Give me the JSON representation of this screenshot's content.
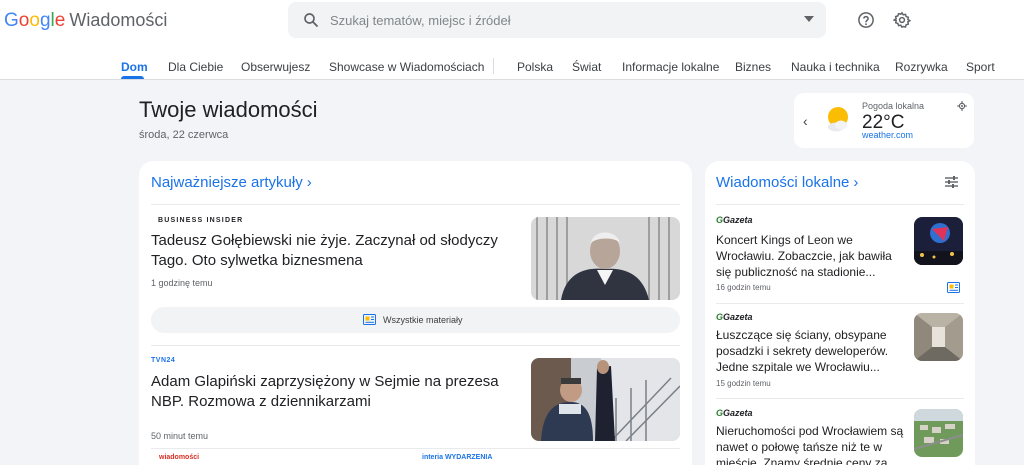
{
  "app": {
    "logo_letters": [
      "G",
      "o",
      "o",
      "g",
      "l",
      "e"
    ],
    "product": "Wiadomości"
  },
  "search": {
    "placeholder": "Szukaj tematów, miejsc i źródeł"
  },
  "header_icons": [
    "help-icon",
    "settings-icon"
  ],
  "nav": {
    "tabs": [
      {
        "label": "Dom",
        "active": true
      },
      {
        "label": "Dla Ciebie"
      },
      {
        "label": "Obserwujesz"
      },
      {
        "label": "Showcase w Wiadomościach"
      },
      {
        "label": "Polska"
      },
      {
        "label": "Świat"
      },
      {
        "label": "Informacje lokalne"
      },
      {
        "label": "Biznes"
      },
      {
        "label": "Nauka i technika"
      },
      {
        "label": "Rozrywka"
      },
      {
        "label": "Sport"
      }
    ]
  },
  "page": {
    "title": "Twoje wiadomości",
    "date": "środa, 22 czerwca"
  },
  "weather": {
    "label": "Pogoda lokalna",
    "temp": "22°C",
    "source": "weather.com"
  },
  "top_stories": {
    "title": "Najważniejsze artykuły",
    "articles": [
      {
        "source": "BUSINESS INSIDER",
        "headline": "Tadeusz Gołębiewski nie żyje. Zaczynał od słodyczy Tago. Oto sylwetka biznesmena",
        "time": "1 godzinę temu"
      },
      {
        "source": "TVN24",
        "headline": "Adam Glapiński zaprzysiężony w Sejmie na prezesa NBP. Rozmowa z dziennikarzami",
        "time": "50 minut temu"
      }
    ],
    "all_coverage": "Wszystkie materiały",
    "more_sources": [
      "wiadomości",
      "interia WYDARZENIA"
    ]
  },
  "local": {
    "title": "Wiadomości lokalne",
    "items": [
      {
        "source": "Gazeta",
        "text": "Koncert Kings of Leon we Wrocławiu. Zobaczcie, jak bawiła się publiczność na stadionie...",
        "time": "16 godzin temu"
      },
      {
        "source": "Gazeta",
        "text": "Łuszczące się ściany, obsypane posadzki i sekrety deweloperów. Jedne szpitale we Wrocławiu...",
        "time": "15 godzin temu"
      },
      {
        "source": "Gazeta",
        "text": "Nieruchomości pod Wrocławiem są nawet o połowę tańsze niż te w mieście. Znamy średnie ceny za...",
        "time": ""
      }
    ]
  },
  "colors": {
    "accent": "#1a73e8",
    "background": "#f2f4f7"
  }
}
